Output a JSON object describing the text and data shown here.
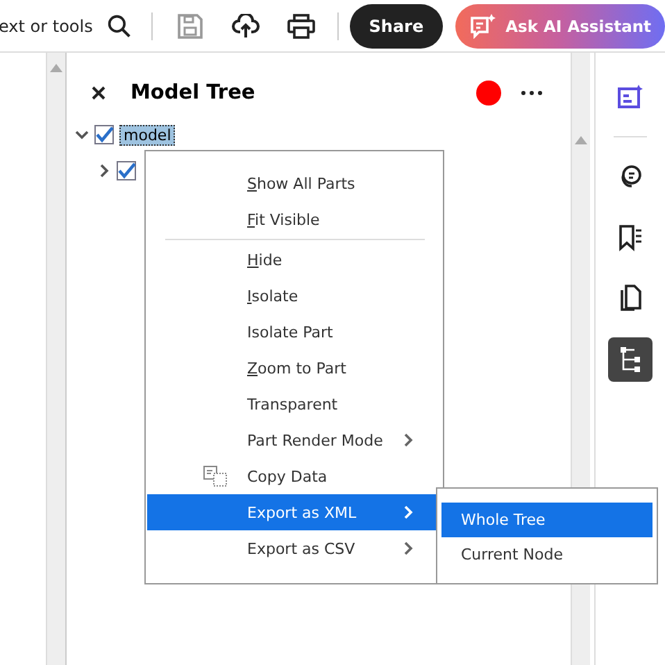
{
  "toolbar": {
    "search_text": "ext or tools",
    "share_label": "Share",
    "ai_label": "Ask AI Assistant"
  },
  "panel": {
    "title": "Model Tree"
  },
  "tree": [
    {
      "label": "model",
      "expanded": true,
      "checked": true,
      "selected": true,
      "children": [
        {
          "expanded": false,
          "checked": true
        }
      ]
    }
  ],
  "context_menu": {
    "items": [
      {
        "kind": "item",
        "label": "Show All Parts",
        "mnemonic": true,
        "submenu": false,
        "selected": false
      },
      {
        "kind": "item",
        "label": "Fit Visible",
        "mnemonic": true,
        "submenu": false,
        "selected": false
      },
      {
        "kind": "separator"
      },
      {
        "kind": "item",
        "label": "Hide",
        "mnemonic": true,
        "submenu": false,
        "selected": false
      },
      {
        "kind": "item",
        "label": "Isolate",
        "mnemonic": true,
        "submenu": false,
        "selected": false
      },
      {
        "kind": "item",
        "label": "Isolate Part",
        "mnemonic": false,
        "submenu": false,
        "selected": false
      },
      {
        "kind": "item",
        "label": "Zoom to Part",
        "mnemonic": true,
        "submenu": false,
        "selected": false
      },
      {
        "kind": "item",
        "label": "Transparent",
        "mnemonic": false,
        "submenu": false,
        "selected": false
      },
      {
        "kind": "item",
        "label": "Part Render Mode",
        "mnemonic": false,
        "submenu": true,
        "selected": false
      },
      {
        "kind": "icon_item",
        "label": "Copy Data",
        "mnemonic": false,
        "submenu": false,
        "selected": false
      },
      {
        "kind": "item",
        "label": "Export as XML",
        "mnemonic": false,
        "submenu": true,
        "selected": true
      },
      {
        "kind": "item",
        "label": "Export as CSV",
        "mnemonic": false,
        "submenu": true,
        "selected": false
      }
    ]
  },
  "submenu": {
    "items": [
      {
        "label": "Whole Tree",
        "selected": true
      },
      {
        "label": "Current Node",
        "selected": false
      }
    ]
  },
  "rail": [
    {
      "kind": "ai",
      "selected": false
    },
    {
      "kind": "comment",
      "selected": false
    },
    {
      "kind": "bookmark",
      "selected": false
    },
    {
      "kind": "pages",
      "selected": false
    },
    {
      "kind": "tree",
      "selected": true
    }
  ]
}
